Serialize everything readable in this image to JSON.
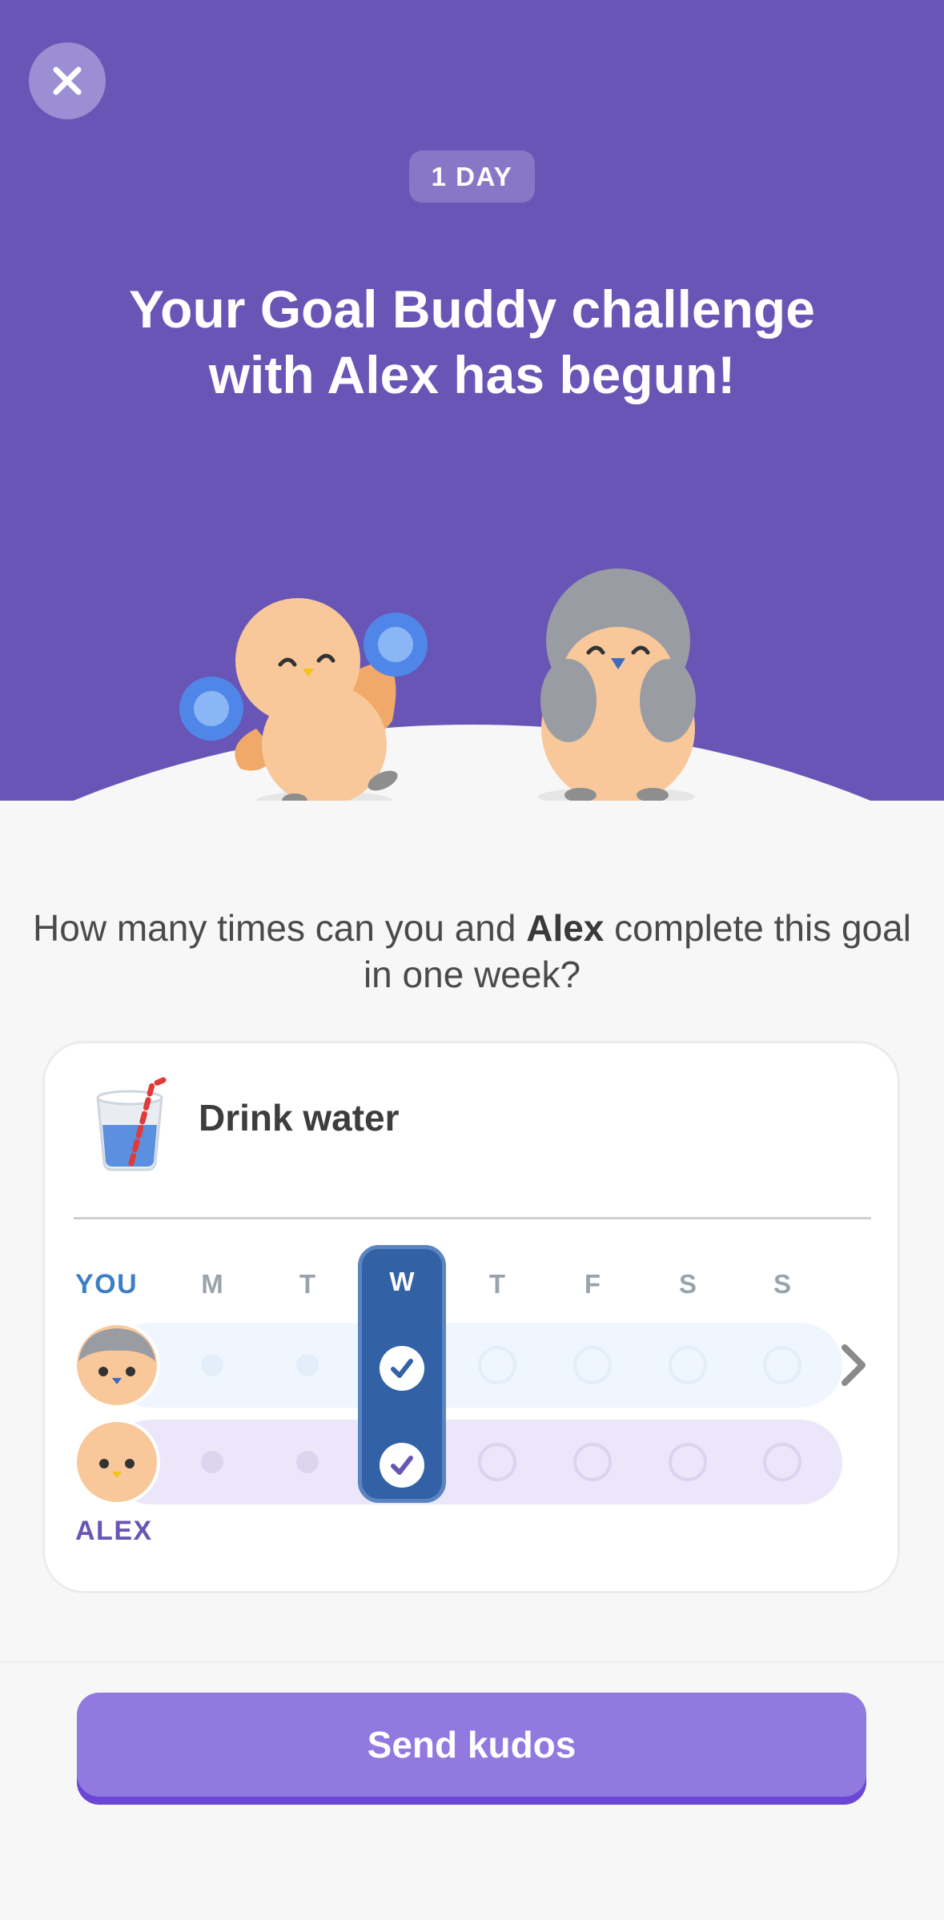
{
  "header": {
    "close_icon": "close-icon",
    "day_badge": "1 DAY",
    "headline_line1": "Your Goal Buddy challenge",
    "headline_line2": "with Alex has begun!"
  },
  "colors": {
    "header_bg": "#6955b5",
    "you_accent": "#3d7fc4",
    "alex_accent": "#6955b5",
    "today_column": "#3261a6",
    "button": "#9179e0"
  },
  "question": {
    "before": "How many times can you and ",
    "buddy": "Alex",
    "after": " complete this goal in one week?"
  },
  "goal": {
    "icon": "water-glass-icon",
    "title": "Drink water"
  },
  "tracker": {
    "you_label": "YOU",
    "buddy_label": "ALEX",
    "days": [
      "M",
      "T",
      "W",
      "T",
      "F",
      "S",
      "S"
    ],
    "today_index": 2,
    "you_status": [
      "past",
      "past",
      "done",
      "future",
      "future",
      "future",
      "future"
    ],
    "buddy_status": [
      "past",
      "past",
      "done",
      "future",
      "future",
      "future",
      "future"
    ],
    "next_icon": "chevron-right-icon"
  },
  "footer": {
    "button_label": "Send kudos"
  }
}
